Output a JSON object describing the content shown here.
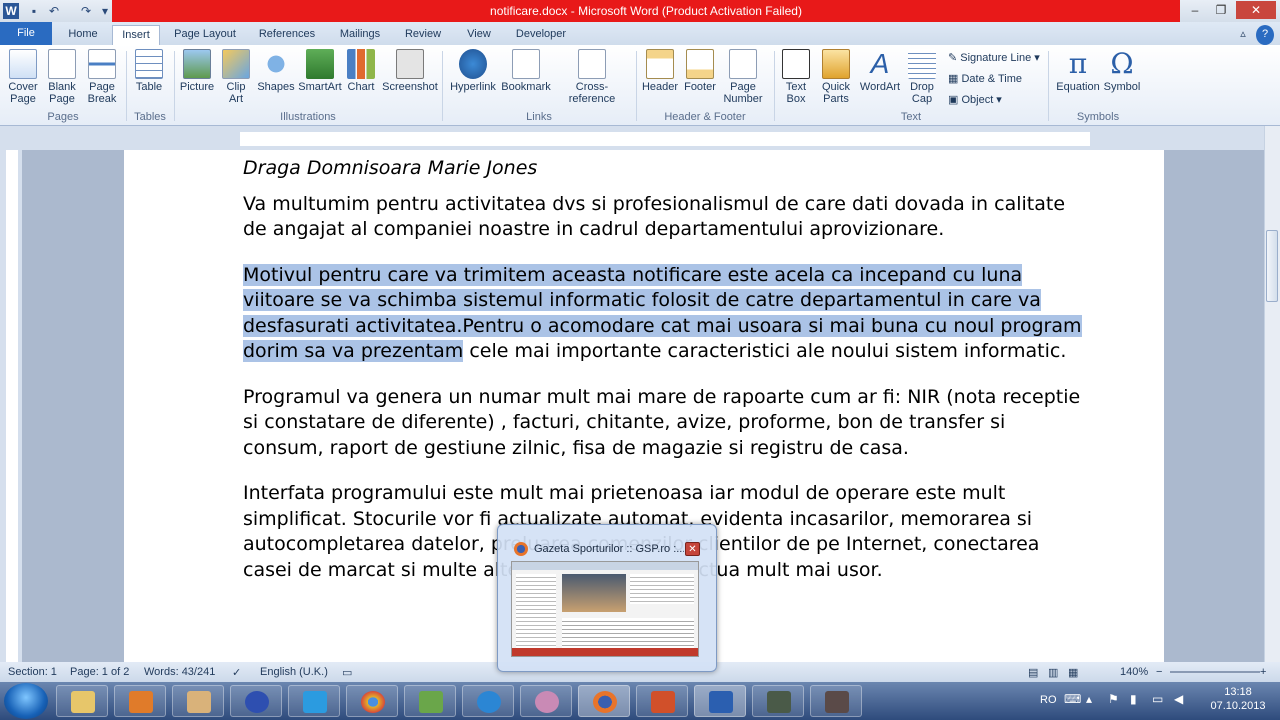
{
  "window": {
    "title": "notificare.docx - Microsoft Word (Product Activation Failed)"
  },
  "tabs": [
    "File",
    "Home",
    "Insert",
    "Page Layout",
    "References",
    "Mailings",
    "Review",
    "View",
    "Developer"
  ],
  "ribbon": {
    "pages": {
      "cover": "Cover Page",
      "blank": "Blank Page",
      "break": "Page Break",
      "group": "Pages"
    },
    "tables": {
      "table": "Table",
      "group": "Tables"
    },
    "illustrations": {
      "picture": "Picture",
      "clipart": "Clip Art",
      "shapes": "Shapes",
      "smartart": "SmartArt",
      "chart": "Chart",
      "screenshot": "Screenshot",
      "group": "Illustrations"
    },
    "links": {
      "hyperlink": "Hyperlink",
      "bookmark": "Bookmark",
      "crossref": "Cross-reference",
      "group": "Links"
    },
    "headerfooter": {
      "header": "Header",
      "footer": "Footer",
      "pagenumber": "Page Number",
      "group": "Header & Footer"
    },
    "text": {
      "textbox": "Text Box",
      "quickparts": "Quick Parts",
      "wordart": "WordArt",
      "dropcap": "Drop Cap",
      "signature": "Signature Line",
      "datetime": "Date & Time",
      "object": "Object",
      "group": "Text"
    },
    "symbols": {
      "equation": "Equation",
      "symbol": "Symbol",
      "group": "Symbols"
    }
  },
  "document": {
    "greeting": "Draga Domnisoara Marie Jones",
    "p1": "Va multumim pentru activitatea dvs si profesionalismul de care dati dovada in calitate de angajat al companiei noastre in cadrul departamentului aprovizionare.",
    "p2_selected": "Motivul pentru care va trimitem aceasta notificare este acela ca incepand cu luna viitoare se va schimba sistemul informatic folosit de catre departamentul in care va desfasurati activitatea.Pentru o acomodare cat mai usoara si mai buna cu noul program dorim sa va prezentam",
    "p2_rest": " cele mai importante caracteristici ale noului sistem informatic.",
    "p3": "Programul va genera un numar mult mai mare de rapoarte cum ar fi: NIR (nota receptie si constatare de diferente) , facturi, chitante, avize, proforme, bon de transfer si consum, raport de gestiune zilnic, fisa de magazie si registru de casa.",
    "p4": "Interfata programului este mult mai prietenoasa iar modul de operare este mult simplificat. Stocurile vor fi actualizate automat, evidenta incasarilor, memorarea si autocompletarea datelor, preluarea comenzilor clientilor de pe Internet, conectarea casei de marcat si multe alte operatii se vor efectua mult mai usor."
  },
  "status": {
    "section": "Section: 1",
    "page": "Page: 1 of 2",
    "words": "Words: 43/241",
    "language": "English (U.K.)",
    "zoom": "140%"
  },
  "preview": {
    "title": "Gazeta Sporturilor :: GSP.ro :..."
  },
  "clock": {
    "time": "13:18",
    "date": "07.10.2013",
    "lang": "RO"
  }
}
